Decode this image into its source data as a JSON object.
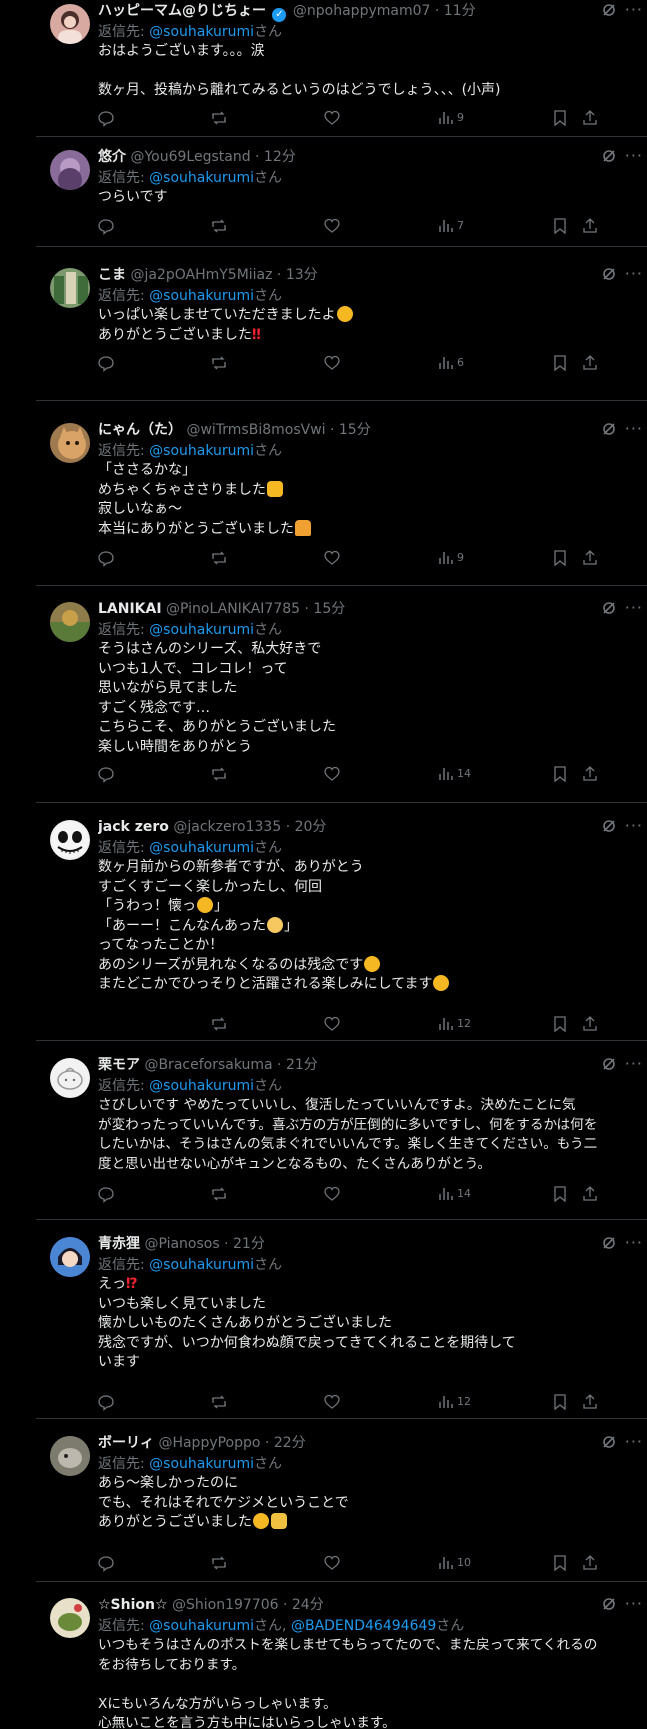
{
  "replies": [
    {
      "name": "ハッピーマム@りじちょー",
      "handle": "@npohappymam07 · 11分",
      "reply_to_prefix": "返信先: ",
      "reply_to": "@souhakurumi",
      "reply_to_suffix": "さん",
      "lines": [
        "おはようございます。。。涙",
        "",
        "数ヶ月、投稿から離れてみるというのはどうでしょう、、、(小声)"
      ],
      "views": "9",
      "avatar_color": "#d7a9a0",
      "verified": true
    },
    {
      "name": "悠介",
      "handle": "@You69Legstand · 12分",
      "reply_to_prefix": "返信先: ",
      "reply_to": "@souhakurumi",
      "reply_to_suffix": "さん",
      "lines": [
        "つらいです"
      ],
      "views": "7",
      "avatar_color": "#8a6c9a"
    },
    {
      "name": "こま",
      "handle": "@ja2pOAHmY5Miiaz · 13分",
      "reply_to_prefix": "返信先: ",
      "reply_to": "@souhakurumi",
      "reply_to_suffix": "さん",
      "lines": [
        "いっぱい楽しませていただきましたよ",
        "ありがとうございました"
      ],
      "views": "6",
      "avatar_color": "#7c9a6e"
    },
    {
      "name": "にゃん（た）",
      "handle": "@wiTrmsBi8mosVwi · 15分",
      "reply_to_prefix": "返信先: ",
      "reply_to": "@souhakurumi",
      "reply_to_suffix": "さん",
      "lines": [
        "「さ​さるかな」",
        "めちゃくちゃささりました",
        "寂しいなぁ〜",
        "本当にありがとうございました"
      ],
      "views": "9",
      "avatar_color": "#a07a4f"
    },
    {
      "name": "LANIKAI",
      "handle": "@PinoLANIKAI7785 · 15分",
      "reply_to_prefix": "返信先: ",
      "reply_to": "@souhakurumi",
      "reply_to_suffix": "さん",
      "lines": [
        "そうはさんのシリーズ、私大好きで",
        "いつも1人で、コレコレ！って",
        "思いながら見てました",
        "すごく残念です…",
        "こちらこそ、ありがとうございました",
        "楽しい時間をありがとう"
      ],
      "views": "14",
      "avatar_color": "#8e7d4a"
    },
    {
      "name": "jack zero",
      "handle": "@jackzero1335 · 20分",
      "reply_to_prefix": "返信先: ",
      "reply_to": "@souhakurumi",
      "reply_to_suffix": "さん",
      "lines": [
        "数ヶ月前からの新参者ですが、ありがとう",
        "すごくすごーく楽しかったし、何回",
        "「うわっ！懐っ",
        "「あーー！こんなんあった",
        "ってなったことか！",
        "あのシリーズが見れなくなるのは残念です",
        "またどこかでひっそりと活躍される楽しみにしてます"
      ],
      "views": "12",
      "avatar_color": "#f0f0f0"
    },
    {
      "name": "栗モア",
      "handle": "@Braceforsakuma · 21分",
      "reply_to_prefix": "返信先: ",
      "reply_to": "@souhakurumi",
      "reply_to_suffix": "さん",
      "lines": [
        "さびしいです やめたっていいし、復活したっていいんですよ。決めたことに気",
        "が変わったっていいんです。喜ぶ方の方が圧倒的に多いですし、何をするかは何を",
        "したいかは、そうはさんの気まぐれでいいんです。楽しく生きてください。もう二",
        "度と思い出せない心がキュンとなるもの、たくさんありがとう。"
      ],
      "views": "14",
      "avatar_color": "#f2f2f2"
    },
    {
      "name": "青赤狸",
      "handle": "@Pianosos · 21分",
      "reply_to_prefix": "返信先: ",
      "reply_to": "@souhakurumi",
      "reply_to_suffix": "さん",
      "lines": [
        "えっ",
        "いつも楽しく見ていました",
        "懐かしいものたくさんありがとうございました",
        "残念ですが、いつか何食わぬ顔で戻ってきてくれることを期待して",
        "います"
      ],
      "views": "12",
      "avatar_color": "#3a6fc4"
    },
    {
      "name": "ボーリィ",
      "handle": "@HappyPoppo · 22分",
      "reply_to_prefix": "返信先: ",
      "reply_to": "@souhakurumi",
      "reply_to_suffix": "さん",
      "lines": [
        "あら〜楽しかったのに",
        "でも、それはそれでケジメということで",
        "ありがとうございました"
      ],
      "views": "10",
      "avatar_color": "#8a8378"
    },
    {
      "name": "☆Shion☆",
      "handle": "@Shion197706 · 24分",
      "reply_to_prefix": "返信先: ",
      "reply_to": "@souhakurumi",
      "reply_to_suffix": "さん, ",
      "reply_to_2": "@BADEND46494649",
      "reply_to_2_suffix": "さん",
      "lines": [
        "いつもそうはさんのポストを楽しませてもらってたので、また戻って来てくれるの",
        "をお待ちしております。",
        "",
        "Xにもいろんな方がいらっしゃいます。",
        "心無いことを言う方も中にはいらっしゃいます。"
      ],
      "views": "",
      "avatar_color": "#6a8a4a"
    }
  ]
}
